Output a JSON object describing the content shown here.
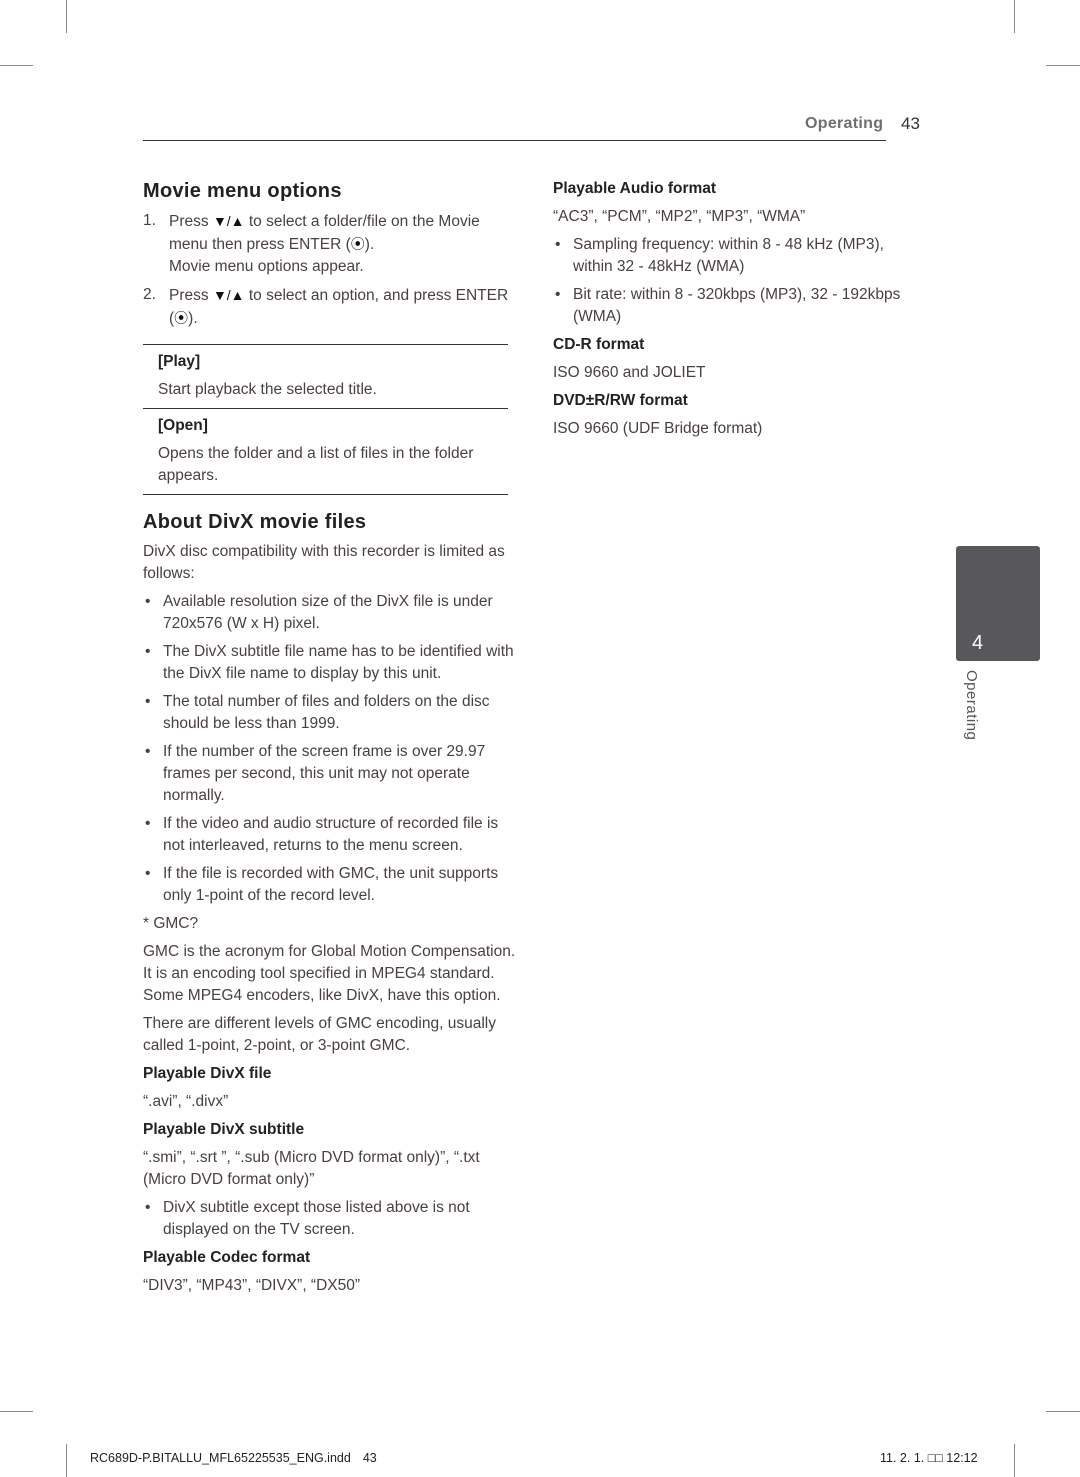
{
  "header": {
    "section": "Operating",
    "page_number": "43"
  },
  "left_column": {
    "movie_menu": {
      "title": "Movie menu options",
      "steps": [
        {
          "num": "1.",
          "pre": "Press ",
          "arrows": "▼/▲",
          "mid": " to select a folder/file on the Movie menu then press ENTER (",
          "enter": "⦿",
          "post": ").",
          "note": "Movie menu options appear."
        },
        {
          "num": "2.",
          "pre": "Press ",
          "arrows": "▼/▲",
          "mid": " to select an option, and press ENTER (",
          "enter": "⦿",
          "post": ")."
        }
      ],
      "options": [
        {
          "name": "[Play]",
          "desc": "Start playback the selected title."
        },
        {
          "name": "[Open]",
          "desc": "Opens the folder and a list of files in the folder appears."
        }
      ]
    },
    "divx": {
      "title": "About DivX movie files",
      "intro": "DivX disc compatibility with this recorder is limited as follows:",
      "bullets": [
        "Available resolution size of the DivX file is under 720x576 (W x H) pixel.",
        "The DivX subtitle file name has to be identified with the DivX file name to display by this unit.",
        "The total number of files and folders on the disc should be less than 1999.",
        "If the number of the screen frame is over 29.97 frames per second, this unit may not operate normally.",
        "If the video and audio structure of recorded file is not interleaved, returns to the menu screen.",
        "If the file is recorded with GMC, the unit supports only 1-point of the record level."
      ],
      "gmc_heading": "* GMC?",
      "gmc_paragraphs": [
        "GMC is the acronym for Global Motion Compensation. It is an encoding tool specified in MPEG4 standard. Some MPEG4 encoders, like DivX, have this option.",
        "There are different levels of GMC encoding, usually called 1-point, 2-point, or 3-point GMC."
      ],
      "playable_file": {
        "title": "Playable DivX file",
        "value": "“.avi”, “.divx”"
      },
      "playable_subtitle": {
        "title": "Playable DivX subtitle",
        "value": "“.smi”, “.srt ”, “.sub (Micro DVD format only)”, “.txt (Micro DVD format only)”",
        "bullets": [
          "DivX subtitle except those listed above is not displayed on the TV screen."
        ]
      },
      "playable_codec": {
        "title": "Playable Codec format",
        "value": "“DIV3”, “MP43”, “DIVX”, “DX50”"
      }
    }
  },
  "right_column": {
    "audio": {
      "title": "Playable Audio format",
      "value": "“AC3”, “PCM”, “MP2”, “MP3”, “WMA”",
      "bullets": [
        "Sampling frequency: within 8 - 48 kHz (MP3), within 32 - 48kHz (WMA)",
        "Bit rate: within 8 - 320kbps (MP3), 32 - 192kbps (WMA)"
      ]
    },
    "cdr": {
      "title": "CD-R format",
      "value": "ISO 9660 and JOLIET"
    },
    "dvd": {
      "title": "DVD±R/RW format",
      "value": "ISO 9660 (UDF Bridge format)"
    }
  },
  "side_tab": {
    "number": "4",
    "label": "Operating",
    "color": "#58585a"
  },
  "bullet_glyph": "•",
  "footer": {
    "file": "RC689D-P.BITALLU_MFL65225535_ENG.indd",
    "page": "43",
    "datetime": "11. 2. 1.   □□ 12:12"
  }
}
